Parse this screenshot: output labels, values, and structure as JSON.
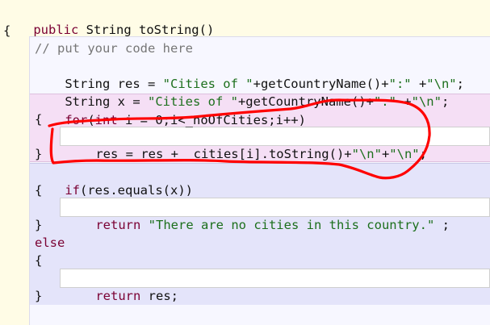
{
  "code": {
    "signature": {
      "kw_public": "public",
      "rest": " String toString()"
    },
    "open_brace": "{",
    "comment": "// put your code here",
    "res_line": {
      "prefix": "String res = ",
      "str1": "\"Cities of \"",
      "middle": "+getCountryName()+",
      "str2": "\":\"",
      "space_plus": " +",
      "str3": "\"\\n\"",
      "suffix": ";"
    },
    "x_line": {
      "prefix": "String x = ",
      "str1": "\"Cities of \"",
      "middle": "+getCountryName()+",
      "str2": "\":\"",
      "space_plus": " +",
      "str3": "\"\\n\"",
      "suffix": ";"
    },
    "for_line": {
      "kw_for": "for",
      "paren": "(",
      "kw_int": "int",
      "rest": " i = 0;i<_noOfCities;i++)"
    },
    "for_open": "{",
    "for_body": {
      "prefix": "res = res + _cities[i].toString()+",
      "str1": "\"\\n\"",
      "plus": "+",
      "str2": "\"\\n\"",
      "suffix": ";"
    },
    "for_close": "}",
    "if_line": {
      "kw_if": "if",
      "rest": "(res.equals(x))"
    },
    "if_open": "{",
    "if_body": {
      "kw_return": "return",
      "space": " ",
      "str": "\"There are no cities in this country.\"",
      "suffix": " ;"
    },
    "if_close": "}",
    "else_kw": "else",
    "else_open": "{",
    "else_body": {
      "kw_return": "return",
      "rest": " res;"
    },
    "else_close": "}"
  },
  "colors": {
    "keyword": "#7a0033",
    "string": "#1c6f1c",
    "comment": "#777777",
    "annotation": "#ff0000"
  }
}
